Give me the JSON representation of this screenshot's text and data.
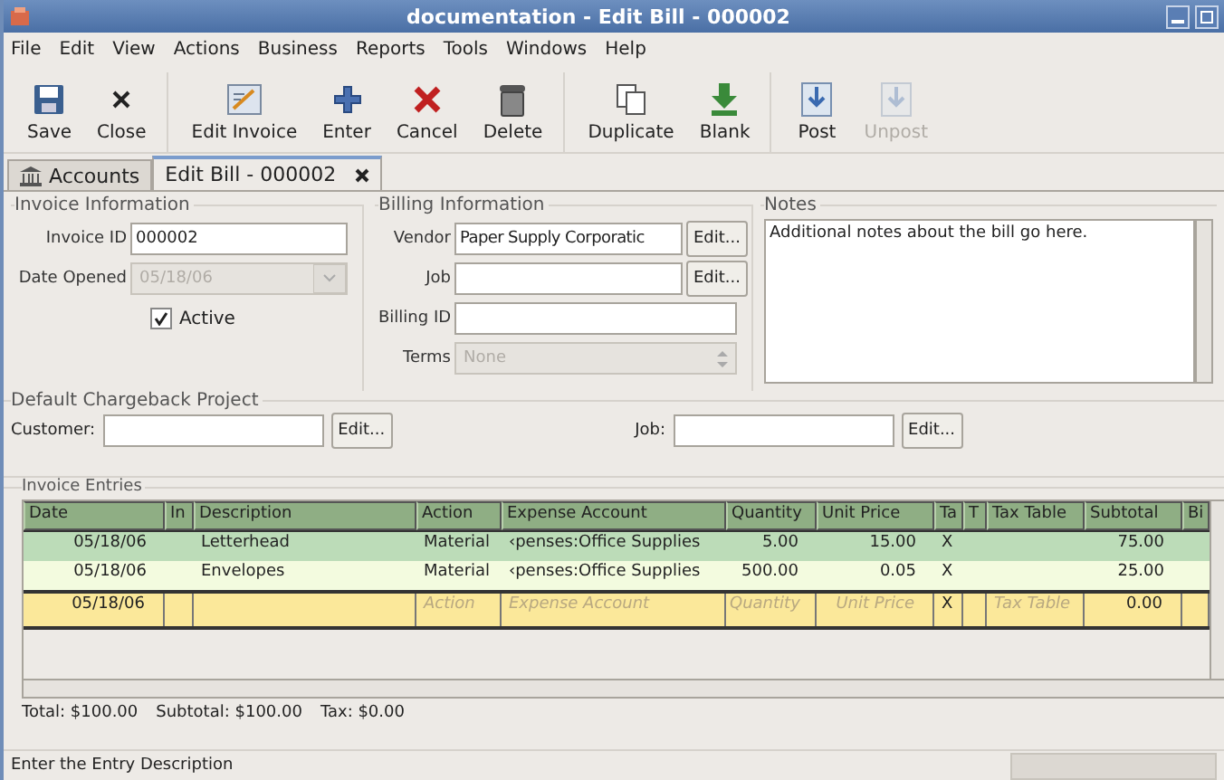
{
  "window": {
    "title": "documentation - Edit Bill - 000002"
  },
  "menu": [
    "File",
    "Edit",
    "View",
    "Actions",
    "Business",
    "Reports",
    "Tools",
    "Windows",
    "Help"
  ],
  "toolbar": [
    [
      {
        "label": "Save",
        "disabled": false
      },
      {
        "label": "Close",
        "disabled": false
      }
    ],
    [
      {
        "label": "Edit Invoice",
        "disabled": false
      },
      {
        "label": "Enter",
        "disabled": false
      },
      {
        "label": "Cancel",
        "disabled": false
      },
      {
        "label": "Delete",
        "disabled": false
      }
    ],
    [
      {
        "label": "Duplicate",
        "disabled": false
      },
      {
        "label": "Blank",
        "disabled": false
      }
    ],
    [
      {
        "label": "Post",
        "disabled": false
      },
      {
        "label": "Unpost",
        "disabled": true
      }
    ]
  ],
  "tabs": [
    {
      "label": "Accounts",
      "selected": false,
      "closable": false
    },
    {
      "label": "Edit Bill - 000002",
      "selected": true,
      "closable": true
    }
  ],
  "invoice_info": {
    "title": "Invoice Information",
    "invoice_id": {
      "label": "Invoice ID",
      "value": "000002"
    },
    "date_opened": {
      "label": "Date Opened",
      "value": "05/18/06",
      "disabled": true
    },
    "active": {
      "label": "Active",
      "checked": true
    }
  },
  "billing_info": {
    "title": "Billing Information",
    "vendor": {
      "label": "Vendor",
      "value": "Paper Supply Corporatic",
      "button": "Edit..."
    },
    "job": {
      "label": "Job",
      "button": "Edit..."
    },
    "billing_id": {
      "label": "Billing ID"
    },
    "terms": {
      "label": "Terms",
      "value": "None",
      "disabled": true
    }
  },
  "notes": {
    "title": "Notes",
    "value": "Additional notes about the bill go here."
  },
  "chargeback": {
    "title": "Default Chargeback Project",
    "customer": {
      "label": "Customer:",
      "button": "Edit..."
    },
    "job": {
      "label": "Job:",
      "button": "Edit..."
    }
  },
  "entries": {
    "title": "Invoice Entries",
    "columns": [
      {
        "label": "Date",
        "kind": "number"
      },
      {
        "label": "In",
        "kind": "text"
      },
      {
        "label": "Description",
        "kind": "text"
      },
      {
        "label": "Action",
        "kind": "text"
      },
      {
        "label": "Expense Account",
        "kind": "text"
      },
      {
        "label": "Quantity",
        "kind": "number"
      },
      {
        "label": "Unit Price",
        "kind": "number"
      },
      {
        "label": "Ta",
        "kind": "text"
      },
      {
        "label": "T",
        "kind": "text"
      },
      {
        "label": "Tax Table",
        "kind": "text"
      },
      {
        "label": "Subtotal",
        "kind": "number"
      },
      {
        "label": "Bi",
        "kind": "text"
      }
    ],
    "rows": [
      {
        "selected": false,
        "cells": [
          "05/18/06",
          "",
          "Letterhead",
          "Material",
          "‹penses:Office Supplies",
          "5.00",
          "15.00",
          "X",
          "",
          "",
          "75.00",
          ""
        ]
      },
      {
        "selected": false,
        "cells": [
          "05/18/06",
          "",
          "Envelopes",
          "Material",
          "‹penses:Office Supplies",
          "500.00",
          "0.05",
          "X",
          "",
          "",
          "25.00",
          ""
        ]
      },
      {
        "selected": true,
        "cells": [
          "05/18/06",
          "",
          "",
          {
            "placeholder": "Action"
          },
          {
            "placeholder": "Expense Account"
          },
          {
            "placeholder": "Quantity"
          },
          {
            "placeholder": "Unit Price"
          },
          "X",
          "",
          {
            "placeholder": "Tax Table"
          },
          "0.00",
          ""
        ]
      }
    ]
  },
  "totals": [
    "Total: $100.00",
    "Subtotal: $100.00",
    "Tax: $0.00"
  ],
  "status_bar": {
    "text": "Enter the Entry Description"
  }
}
